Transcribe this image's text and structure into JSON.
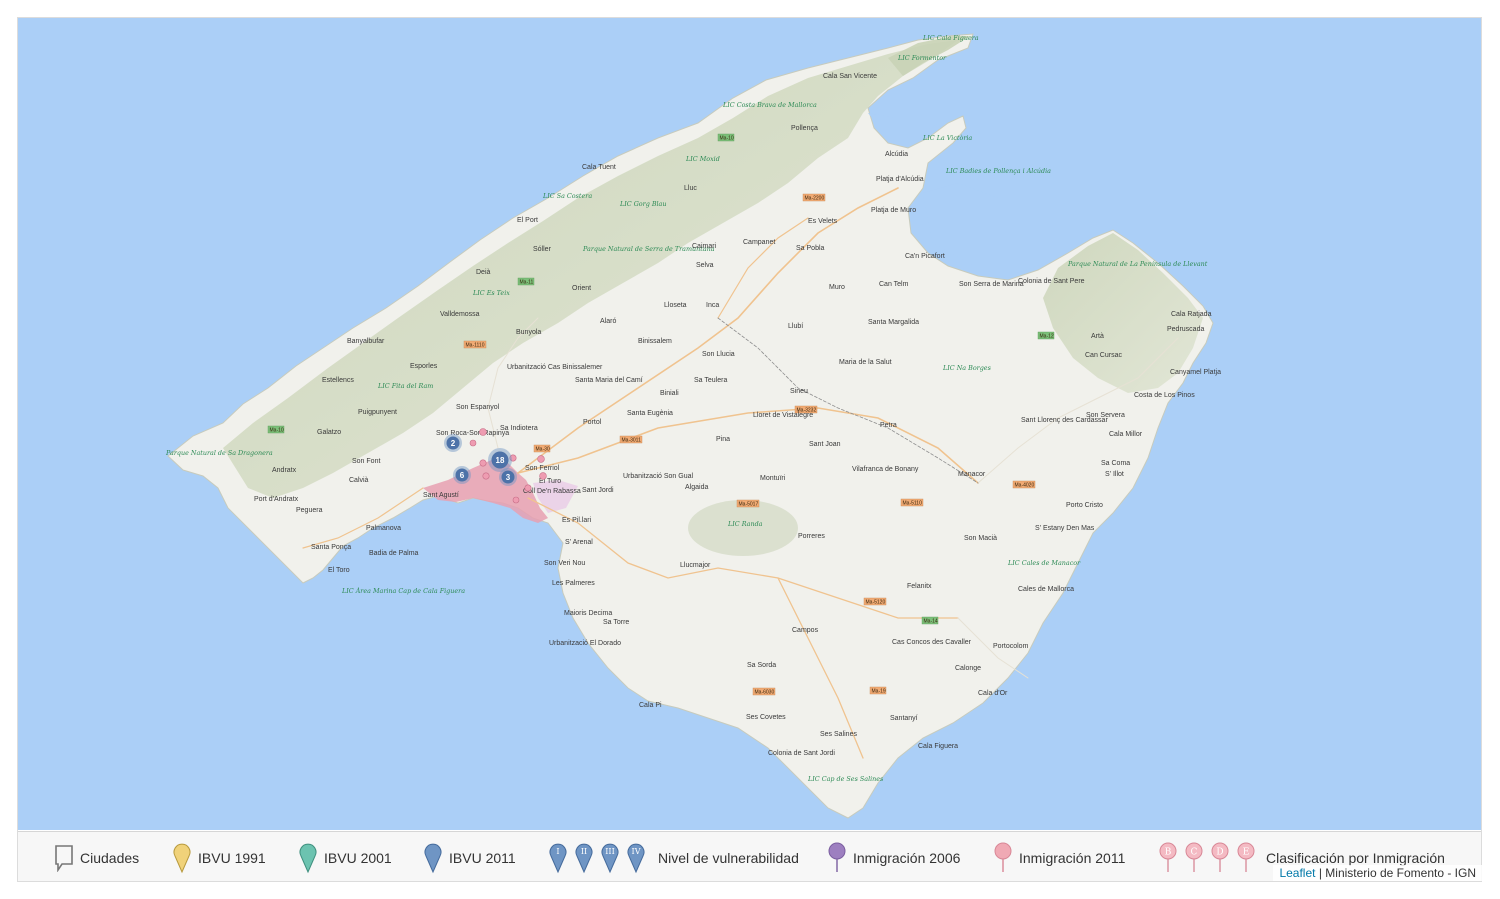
{
  "map": {
    "places": [
      {
        "id": "cala-san-vicente",
        "text": "Cala San Vicente"
      },
      {
        "id": "pollenca",
        "text": "Pollença"
      },
      {
        "id": "alcudia",
        "text": "Alcúdia"
      },
      {
        "id": "platja-alcudia",
        "text": "Platja d'Alcúdia"
      },
      {
        "id": "cala-tuent",
        "text": "Cala Tuent"
      },
      {
        "id": "lluc",
        "text": "Lluc"
      },
      {
        "id": "el-port",
        "text": "El Port"
      },
      {
        "id": "soller",
        "text": "Sóller"
      },
      {
        "id": "caimari",
        "text": "Caimari"
      },
      {
        "id": "campanet",
        "text": "Campanet"
      },
      {
        "id": "sa-pobla",
        "text": "Sa Pobla"
      },
      {
        "id": "es-velets",
        "text": "Es Velets"
      },
      {
        "id": "platja-de-muro",
        "text": "Platja de Muro"
      },
      {
        "id": "deia",
        "text": "Deià"
      },
      {
        "id": "selva",
        "text": "Selva"
      },
      {
        "id": "orient",
        "text": "Orient"
      },
      {
        "id": "lloseta",
        "text": "Lloseta"
      },
      {
        "id": "inca",
        "text": "Inca"
      },
      {
        "id": "muro",
        "text": "Muro"
      },
      {
        "id": "can-picafort",
        "text": "Ca'n Picafort"
      },
      {
        "id": "valldemossa",
        "text": "Valldemossa"
      },
      {
        "id": "bunyola",
        "text": "Bunyola"
      },
      {
        "id": "alaro",
        "text": "Alaró"
      },
      {
        "id": "llubi",
        "text": "Llubí"
      },
      {
        "id": "can-telm",
        "text": "Can Telm"
      },
      {
        "id": "son-serra",
        "text": "Son Serra de Marina"
      },
      {
        "id": "colonia-sant-pere",
        "text": "Colonia de Sant Pere"
      },
      {
        "id": "banyalbufar",
        "text": "Banyalbufar"
      },
      {
        "id": "binissalem",
        "text": "Binissalem"
      },
      {
        "id": "son-llucia",
        "text": "Son Llucia"
      },
      {
        "id": "santa-margalida",
        "text": "Santa Margalida"
      },
      {
        "id": "cala-ratjada",
        "text": "Cala Ratjada"
      },
      {
        "id": "pedruscada",
        "text": "Pedruscada"
      },
      {
        "id": "arta",
        "text": "Artà"
      },
      {
        "id": "can-cursac",
        "text": "Can Cursac"
      },
      {
        "id": "esporles",
        "text": "Esporles"
      },
      {
        "id": "urbanitzacio-cas-binissalemer",
        "text": "Urbanització Cas Binissalemer"
      },
      {
        "id": "estellencs",
        "text": "Estellencs"
      },
      {
        "id": "santa-maria",
        "text": "Santa Maria del Camí"
      },
      {
        "id": "sa-teulera",
        "text": "Sa Teulera"
      },
      {
        "id": "biniali",
        "text": "Biniali"
      },
      {
        "id": "maria-de-la-salut",
        "text": "Maria de la Salut"
      },
      {
        "id": "canyamel",
        "text": "Canyamel Platja"
      },
      {
        "id": "costa-dels-pins",
        "text": "Costa de Los Pinos"
      },
      {
        "id": "sineu",
        "text": "Sineu"
      },
      {
        "id": "puigpunyent",
        "text": "Puigpunyent"
      },
      {
        "id": "son-espanyol",
        "text": "Son Espanyol"
      },
      {
        "id": "santa-eugenia",
        "text": "Santa Eugènia"
      },
      {
        "id": "lloret",
        "text": "Lloret de Vistalegre"
      },
      {
        "id": "portol",
        "text": "Portol"
      },
      {
        "id": "sant-llorenc",
        "text": "Sant Llorenç des Cardassar"
      },
      {
        "id": "son-servera",
        "text": "Son Servera"
      },
      {
        "id": "son-roca",
        "text": "Son Roca-Son Rapinya"
      },
      {
        "id": "sa-indiotera",
        "text": "Sa Indiotera"
      },
      {
        "id": "galatzo",
        "text": "Galatzo"
      },
      {
        "id": "petra",
        "text": "Petra"
      },
      {
        "id": "cala-millor",
        "text": "Cala Millor"
      },
      {
        "id": "pina",
        "text": "Pina"
      },
      {
        "id": "sant-joan",
        "text": "Sant Joan"
      },
      {
        "id": "son-font",
        "text": "Son Font"
      },
      {
        "id": "son-ferriol",
        "text": "Son Ferriol"
      },
      {
        "id": "sa-coma",
        "text": "Sa Coma"
      },
      {
        "id": "silot",
        "text": "S' Illot"
      },
      {
        "id": "andratx",
        "text": "Andratx"
      },
      {
        "id": "calvia",
        "text": "Calvià"
      },
      {
        "id": "el-turo",
        "text": "El Turo"
      },
      {
        "id": "urbanitzacio-son-gual",
        "text": "Urbanització Son Gual"
      },
      {
        "id": "montuiri",
        "text": "Montuïri"
      },
      {
        "id": "vilafranca",
        "text": "Vilafranca de Bonany"
      },
      {
        "id": "manacor",
        "text": "Manacor"
      },
      {
        "id": "sant-agusti",
        "text": "Sant Agustí"
      },
      {
        "id": "sant-jordi",
        "text": "Sant Jordi"
      },
      {
        "id": "coll-den-rabassa",
        "text": "Coll De'n Rabassa"
      },
      {
        "id": "algaida",
        "text": "Algaida"
      },
      {
        "id": "port-andratx",
        "text": "Port d'Andratx"
      },
      {
        "id": "peguera",
        "text": "Peguera"
      },
      {
        "id": "porto-cristo",
        "text": "Porto Cristo"
      },
      {
        "id": "es-pil-lari",
        "text": "Es Pil.lari"
      },
      {
        "id": "sestany",
        "text": "S' Estany Den Mas"
      },
      {
        "id": "palmanova",
        "text": "Palmanova"
      },
      {
        "id": "sarenal",
        "text": "S' Arenal"
      },
      {
        "id": "porreres",
        "text": "Porreres"
      },
      {
        "id": "son-macia",
        "text": "Son Macià"
      },
      {
        "id": "santa-ponca",
        "text": "Santa Ponça"
      },
      {
        "id": "badia-de-palma",
        "text": "Badia de Palma"
      },
      {
        "id": "son-veri-nou",
        "text": "Son Veri Nou"
      },
      {
        "id": "llucmajor",
        "text": "Llucmajor"
      },
      {
        "id": "el-toro",
        "text": "El Toro"
      },
      {
        "id": "les-palmeres",
        "text": "Les Palmeres"
      },
      {
        "id": "felanitx",
        "text": "Felanitx"
      },
      {
        "id": "cales-de-mallorca",
        "text": "Cales de Mallorca"
      },
      {
        "id": "maioris",
        "text": "Maioris Decima"
      },
      {
        "id": "sa-torre",
        "text": "Sa Torre"
      },
      {
        "id": "campos",
        "text": "Campos"
      },
      {
        "id": "urbanitzacio-el-dorado",
        "text": "Urbanització El Dorado"
      },
      {
        "id": "cas-concos",
        "text": "Cas Concos des Cavaller"
      },
      {
        "id": "portocolom",
        "text": "Portocolom"
      },
      {
        "id": "sa-sorda",
        "text": "Sa Sorda"
      },
      {
        "id": "calonge",
        "text": "Calonge"
      },
      {
        "id": "cala-dor",
        "text": "Cala d'Or"
      },
      {
        "id": "cala-pi",
        "text": "Cala Pi"
      },
      {
        "id": "ses-covetes",
        "text": "Ses Covetes"
      },
      {
        "id": "santanyi",
        "text": "Santanyí"
      },
      {
        "id": "ses-salines",
        "text": "Ses Salines"
      },
      {
        "id": "cala-figuera",
        "text": "Cala Figuera"
      },
      {
        "id": "colonia-sant-jordi",
        "text": "Colonia de Sant Jordi"
      }
    ],
    "protected_areas": [
      {
        "id": "lic-cala-figuera",
        "text": "LIC Cala Figuera"
      },
      {
        "id": "lic-formentor",
        "text": "LIC Formentor"
      },
      {
        "id": "lic-costa-brava",
        "text": "LIC Costa Brava de Mallorca"
      },
      {
        "id": "lic-la-victoria",
        "text": "LIC La Victòria"
      },
      {
        "id": "lic-moxid",
        "text": "LIC Moxid"
      },
      {
        "id": "lic-badies",
        "text": "LIC Badies de Pollença i Alcúdia"
      },
      {
        "id": "lic-sa-costera",
        "text": "LIC Sa Costera"
      },
      {
        "id": "lic-gorg-blau",
        "text": "LIC Gorg Blau"
      },
      {
        "id": "parque-tramuntana",
        "text": "Parque Natural de Serra de Tramuntana"
      },
      {
        "id": "lic-es-teix",
        "text": "LIC Es Teix"
      },
      {
        "id": "parque-llevant",
        "text": "Parque Natural de La Península de Llevant"
      },
      {
        "id": "lic-na-borges",
        "text": "LIC Na Borges"
      },
      {
        "id": "lic-fita-del-ram",
        "text": "LIC Fita del Ram"
      },
      {
        "id": "parque-dragonera",
        "text": "Parque Natural de Sa Dragonera"
      },
      {
        "id": "lic-randa",
        "text": "LIC Randa"
      },
      {
        "id": "lic-cales-de-manacor",
        "text": "LIC Cales de Manacor"
      },
      {
        "id": "lic-area-marina",
        "text": "LIC Àrea Marina Cap de Cala Figuera"
      },
      {
        "id": "lic-cap-ses-salines",
        "text": "LIC Cap de Ses Salines"
      }
    ],
    "roads": [
      "Ma-10",
      "Ma-2200",
      "Ma-11",
      "Ma-1110",
      "Ma-12",
      "Ma-3232",
      "Ma-30",
      "Ma-3011",
      "Ma-4020",
      "Ma-5017",
      "Ma-5110",
      "Ma-14",
      "Ma-5120",
      "Ma-6030",
      "Ma-19",
      "Ma-10"
    ],
    "clusters": [
      {
        "id": "cluster-2",
        "count": "2"
      },
      {
        "id": "cluster-18",
        "count": "18"
      },
      {
        "id": "cluster-6",
        "count": "6"
      },
      {
        "id": "cluster-3",
        "count": "3"
      }
    ]
  },
  "legend": {
    "items": [
      {
        "key": "ciudades",
        "label": "Ciudades",
        "icon": "speech-bubble-icon",
        "color": "#777777"
      },
      {
        "key": "ibvu1991",
        "label": "IBVU 1991",
        "icon": "map-pin-icon",
        "color": "#f0d27a"
      },
      {
        "key": "ibvu2001",
        "label": "IBVU 2001",
        "icon": "map-pin-icon",
        "color": "#6cc3b0"
      },
      {
        "key": "ibvu2011",
        "label": "IBVU 2011",
        "icon": "map-pin-icon",
        "color": "#6f95c4"
      },
      {
        "key": "nivel",
        "label": "Nivel de vulnerabilidad",
        "icon": "roman-pin-icon",
        "color": "#6f95c4",
        "levels": [
          "I",
          "II",
          "III",
          "IV"
        ]
      },
      {
        "key": "inmig2006",
        "label": "Inmigración 2006",
        "icon": "round-pin-icon",
        "color": "#9d7fc0"
      },
      {
        "key": "inmig2011",
        "label": "Inmigración 2011",
        "icon": "round-pin-icon",
        "color": "#f0a9b4"
      },
      {
        "key": "clasif",
        "label": "Clasificación por Inmigración",
        "icon": "letter-pin-icon",
        "color": "#f0a9b4",
        "letters": [
          "B",
          "C",
          "D",
          "E"
        ]
      }
    ]
  },
  "attribution": {
    "link_text": "Leaflet",
    "separator": " | ",
    "source": "Ministerio de Fomento - IGN"
  }
}
